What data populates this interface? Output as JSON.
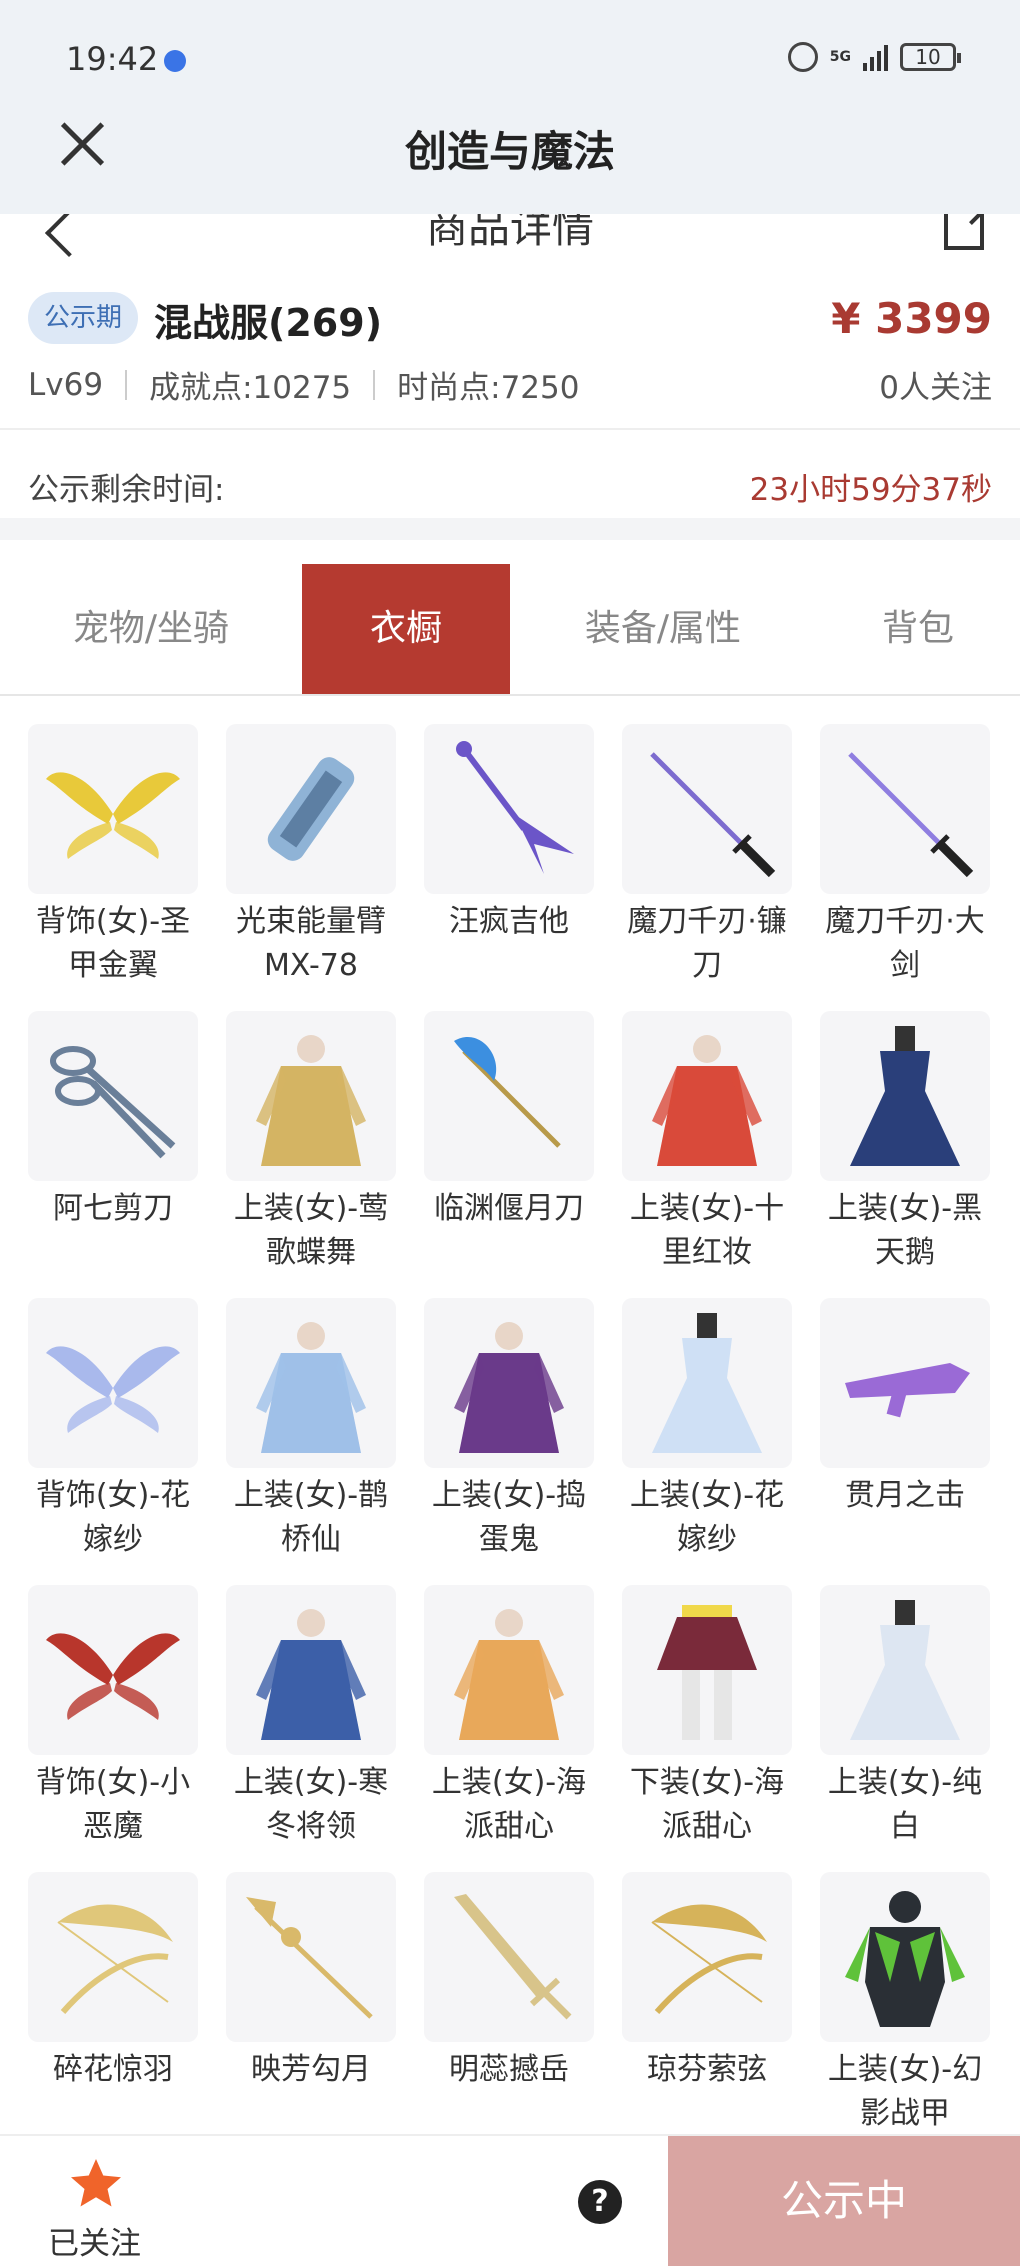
{
  "status_bar": {
    "time": "19:42",
    "network": "5G",
    "battery": "10"
  },
  "app": {
    "title": "创造与魔法"
  },
  "subheader": {
    "title": "商品详情"
  },
  "product": {
    "badge": "公示期",
    "name": "混战服(269)",
    "price": "¥ 3399",
    "level": "Lv69",
    "achievement": "成就点:10275",
    "fashion": "时尚点:7250",
    "followers": "0人关注"
  },
  "countdown": {
    "label": "公示剩余时间:",
    "value": "23小时59分37秒"
  },
  "tabs": [
    {
      "label": "宠物/坐骑",
      "active": false
    },
    {
      "label": "衣橱",
      "active": true
    },
    {
      "label": "装备/属性",
      "active": false
    },
    {
      "label": "背包",
      "active": false
    }
  ],
  "items": [
    {
      "label": "背饰(女)-圣甲金翼",
      "icon": "wings-icon",
      "color": "#e8c93a"
    },
    {
      "label": "光束能量臂MX-78",
      "icon": "cannon-icon",
      "color": "#8fb3d6"
    },
    {
      "label": "汪疯吉他",
      "icon": "guitar-icon",
      "color": "#6b55c8"
    },
    {
      "label": "魔刀千刃·镰刀",
      "icon": "blade-icon",
      "color": "#7d6ccf"
    },
    {
      "label": "魔刀千刃·大剑",
      "icon": "blade-icon",
      "color": "#8f7ee0"
    },
    {
      "label": "阿七剪刀",
      "icon": "scissors-icon",
      "color": "#6a7f99"
    },
    {
      "label": "上装(女)-莺歌蝶舞",
      "icon": "outfit-icon",
      "color": "#d4b463"
    },
    {
      "label": "临渊偃月刀",
      "icon": "glaive-icon",
      "color": "#3c8fe0"
    },
    {
      "label": "上装(女)-十里红妆",
      "icon": "outfit-icon",
      "color": "#d94a3a"
    },
    {
      "label": "上装(女)-黑天鹅",
      "icon": "dress-icon",
      "color": "#2a3f7a"
    },
    {
      "label": "背饰(女)-花嫁纱",
      "icon": "wings-icon",
      "color": "#a9b9ec"
    },
    {
      "label": "上装(女)-鹊桥仙",
      "icon": "outfit-icon",
      "color": "#9fc0e8"
    },
    {
      "label": "上装(女)-捣蛋鬼",
      "icon": "outfit-icon",
      "color": "#6a3a8a"
    },
    {
      "label": "上装(女)-花嫁纱",
      "icon": "dress-icon",
      "color": "#cfe0f5"
    },
    {
      "label": "贯月之击",
      "icon": "gun-icon",
      "color": "#9a6ad6"
    },
    {
      "label": "背饰(女)-小恶魔",
      "icon": "wings-icon",
      "color": "#b8362c"
    },
    {
      "label": "上装(女)-寒冬将领",
      "icon": "outfit-icon",
      "color": "#3c5fa8"
    },
    {
      "label": "上装(女)-海派甜心",
      "icon": "outfit-icon",
      "color": "#e8a85a"
    },
    {
      "label": "下装(女)-海派甜心",
      "icon": "skirt-icon",
      "color": "#7a2a3a"
    },
    {
      "label": "上装(女)-纯白",
      "icon": "dress-icon",
      "color": "#dde6f2"
    },
    {
      "label": "碎花惊羽",
      "icon": "bow-icon",
      "color": "#e0c77a"
    },
    {
      "label": "映芳勾月",
      "icon": "spear-icon",
      "color": "#d9b96a"
    },
    {
      "label": "明蕊撼岳",
      "icon": "sword-icon",
      "color": "#d8c48a"
    },
    {
      "label": "琼芬萦弦",
      "icon": "bow-icon",
      "color": "#d6b35a"
    },
    {
      "label": "上装(女)-幻影战甲",
      "icon": "armor-icon",
      "color": "#5fc23a"
    }
  ],
  "bottom_bar": {
    "follow_label": "已关注",
    "help": "?",
    "button": "公示中"
  }
}
